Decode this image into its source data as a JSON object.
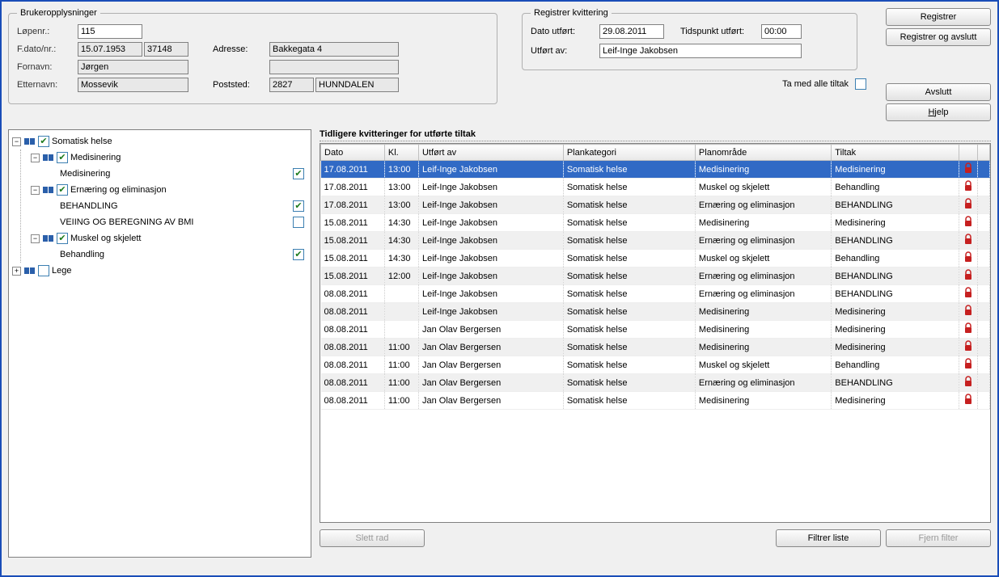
{
  "userInfo": {
    "legend": "Brukeropplysninger",
    "lopenrLabel": "Løpenr.:",
    "lopenr": "115",
    "fdatoLabel": "F.dato/nr.:",
    "fdato": "15.07.1953",
    "fnr": "37148",
    "fornavnLabel": "Fornavn:",
    "fornavn": "Jørgen",
    "etternavnLabel": "Etternavn:",
    "etternavn": "Mossevik",
    "adresseLabel": "Adresse:",
    "adresse": "Bakkegata 4",
    "adresse2": "",
    "poststedLabel": "Poststed:",
    "postnr": "2827",
    "poststed": "HUNNDALEN"
  },
  "receipt": {
    "legend": "Registrer kvittering",
    "datoLabel": "Dato utført:",
    "dato": "29.08.2011",
    "tidLabel": "Tidspunkt utført:",
    "tid": "00:00",
    "utfortAvLabel": "Utført av:",
    "utfortAv": "Leif-Inge Jakobsen"
  },
  "buttons": {
    "registrer": "Registrer",
    "registrerAvslutt": "Registrer og avslutt",
    "avslutt": "Avslutt",
    "hjelp": "Hjelp",
    "slettRad": "Slett rad",
    "filtrerListe": "Filtrer liste",
    "fjernFilter": "Fjern filter"
  },
  "taMedAlle": "Ta med alle tiltak",
  "gridTitle": "Tidligere kvitteringer for utførte tiltak",
  "gridHeaders": {
    "dato": "Dato",
    "kl": "Kl.",
    "utfortAv": "Utført av",
    "plankategori": "Plankategori",
    "planomrade": "Planområde",
    "tiltak": "Tiltak"
  },
  "tree": {
    "n0": "Somatisk helse",
    "n1": "Medisinering",
    "n1a": "Medisinering",
    "n2": "Ernæring og eliminasjon",
    "n2a": "BEHANDLING",
    "n2b": "VEIING OG BEREGNING AV BMI",
    "n3": "Muskel og skjelett",
    "n3a": "Behandling",
    "n4": "Lege"
  },
  "rows": [
    {
      "dato": "17.08.2011",
      "kl": "13:00",
      "utf": "Leif-Inge Jakobsen",
      "plan": "Somatisk helse",
      "omr": "Medisinering",
      "tiltak": "Medisinering",
      "sel": true
    },
    {
      "dato": "17.08.2011",
      "kl": "13:00",
      "utf": "Leif-Inge Jakobsen",
      "plan": "Somatisk helse",
      "omr": "Muskel og skjelett",
      "tiltak": "Behandling"
    },
    {
      "dato": "17.08.2011",
      "kl": "13:00",
      "utf": "Leif-Inge Jakobsen",
      "plan": "Somatisk helse",
      "omr": "Ernæring og eliminasjon",
      "tiltak": "BEHANDLING",
      "alt": true
    },
    {
      "dato": "15.08.2011",
      "kl": "14:30",
      "utf": "Leif-Inge Jakobsen",
      "plan": "Somatisk helse",
      "omr": "Medisinering",
      "tiltak": "Medisinering"
    },
    {
      "dato": "15.08.2011",
      "kl": "14:30",
      "utf": "Leif-Inge Jakobsen",
      "plan": "Somatisk helse",
      "omr": "Ernæring og eliminasjon",
      "tiltak": "BEHANDLING",
      "alt": true
    },
    {
      "dato": "15.08.2011",
      "kl": "14:30",
      "utf": "Leif-Inge Jakobsen",
      "plan": "Somatisk helse",
      "omr": "Muskel og skjelett",
      "tiltak": "Behandling"
    },
    {
      "dato": "15.08.2011",
      "kl": "12:00",
      "utf": "Leif-Inge Jakobsen",
      "plan": "Somatisk helse",
      "omr": "Ernæring og eliminasjon",
      "tiltak": "BEHANDLING",
      "alt": true
    },
    {
      "dato": "08.08.2011",
      "kl": "",
      "utf": "Leif-Inge Jakobsen",
      "plan": "Somatisk helse",
      "omr": "Ernæring og eliminasjon",
      "tiltak": "BEHANDLING"
    },
    {
      "dato": "08.08.2011",
      "kl": "",
      "utf": "Leif-Inge Jakobsen",
      "plan": "Somatisk helse",
      "omr": "Medisinering",
      "tiltak": "Medisinering",
      "alt": true
    },
    {
      "dato": "08.08.2011",
      "kl": "",
      "utf": "Jan Olav Bergersen",
      "plan": "Somatisk helse",
      "omr": "Medisinering",
      "tiltak": "Medisinering"
    },
    {
      "dato": "08.08.2011",
      "kl": "11:00",
      "utf": "Jan Olav Bergersen",
      "plan": "Somatisk helse",
      "omr": "Medisinering",
      "tiltak": "Medisinering",
      "alt": true
    },
    {
      "dato": "08.08.2011",
      "kl": "11:00",
      "utf": "Jan Olav Bergersen",
      "plan": "Somatisk helse",
      "omr": "Muskel og skjelett",
      "tiltak": "Behandling"
    },
    {
      "dato": "08.08.2011",
      "kl": "11:00",
      "utf": "Jan Olav Bergersen",
      "plan": "Somatisk helse",
      "omr": "Ernæring og eliminasjon",
      "tiltak": "BEHANDLING",
      "alt": true
    },
    {
      "dato": "08.08.2011",
      "kl": "11:00",
      "utf": "Jan Olav Bergersen",
      "plan": "Somatisk helse",
      "omr": "Medisinering",
      "tiltak": "Medisinering"
    }
  ]
}
